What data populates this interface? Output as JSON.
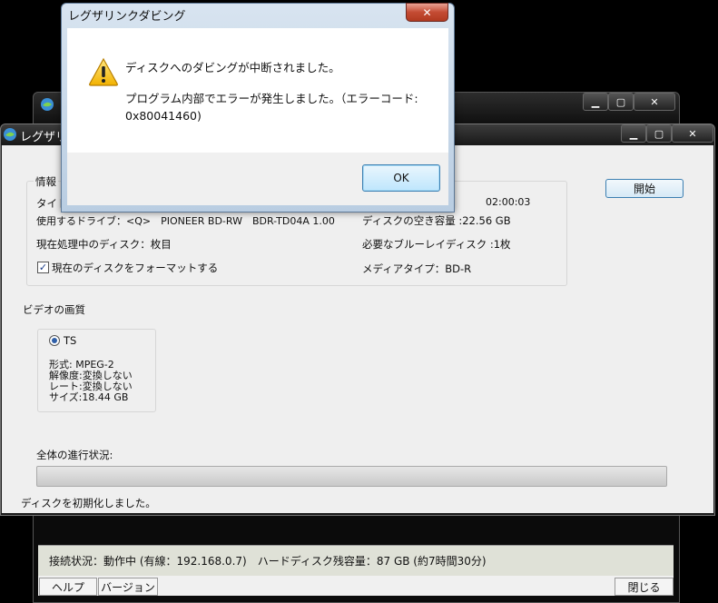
{
  "back_window": {
    "status_text": "接続状況：動作中 (有線：192.168.0.7)　ハードディスク残容量：87 GB (約7時間30分)",
    "help_label": "ヘルプ",
    "version_label": "バージョン",
    "close_label": "閉じる"
  },
  "main_window": {
    "title": "レグザリ",
    "info_group_label": "情報",
    "title_label_partial": "タイト",
    "duration": "02:00:03",
    "drive": "使用するドライブ：<Q>　PIONEER BD-RW　BDR-TD04A 1.00",
    "free_space": "ディスクの空き容量 :22.56 GB",
    "current_disc": "現在処理中のディスク：枚目",
    "required_discs": "必要なブルーレイディスク :1枚",
    "format_checkbox_label": "現在のディスクをフォーマットする",
    "format_checked": true,
    "media_type": "メディアタイプ：BD-R",
    "start_button": "開始",
    "video_quality_label": "ビデオの画質",
    "radio_ts_label": "TS",
    "format_info": "形式: MPEG-2",
    "resolution_info": "解像度:変換しない",
    "rate_info": "レート:変換しない",
    "size_info": "サイズ:18.44 GB",
    "overall_progress_label": "全体の進行状況:",
    "progress_value": 0,
    "status_message": "ディスクを初期化しました。"
  },
  "dialog": {
    "title": "レグザリンクダビング",
    "close_glyph": "✕",
    "message1": "ディスクへのダビングが中断されました。",
    "message2": "プログラム内部でエラーが発生しました。（エラーコード: 0x80041460)",
    "ok_label": "OK",
    "icon": "warning-icon"
  }
}
